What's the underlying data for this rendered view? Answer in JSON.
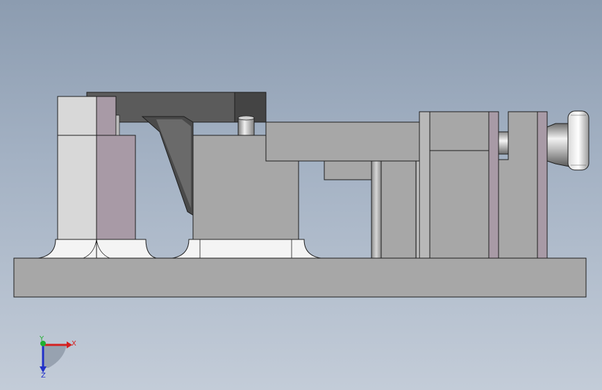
{
  "viewport": {
    "background_top": "#8c9cb0",
    "background_bottom": "#c3ccd8"
  },
  "model": {
    "part_color": "#a7a7a7",
    "edge_color": "#1e1e1e",
    "highlight_color": "#f4f4f4",
    "mauve_color": "#a89aa6"
  },
  "triad": {
    "x_label": "X",
    "y_label": "Y",
    "z_label": "Z",
    "x_color": "#d42020",
    "y_color": "#20b030",
    "z_color": "#2030c8"
  }
}
